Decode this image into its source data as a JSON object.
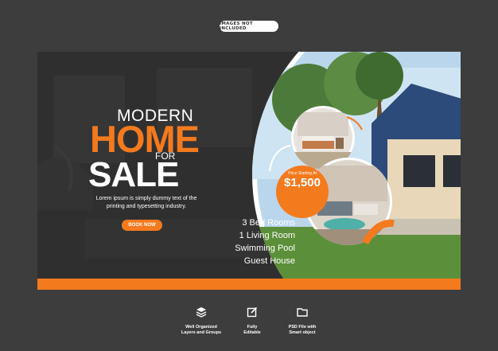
{
  "badge": {
    "label": "IMAGES NOT INCLUDED"
  },
  "headline": {
    "line1": "MODERN",
    "line2": "HOME",
    "line3": "FOR",
    "line4": "SALE"
  },
  "description": "Lorem ipsum is simply dummy text of the printing and typesetting industry.",
  "cta": {
    "label": "BOOK NOW"
  },
  "price": {
    "caption": "Price Starting At",
    "value": "$1,500"
  },
  "features": [
    "3 Bed Rooms",
    "1 Living Room",
    "Swimming Pool",
    "Guest House"
  ],
  "footer_icons": [
    {
      "icon": "layers-icon",
      "label": "Well Organized\nLayers and Groups"
    },
    {
      "icon": "edit-icon",
      "label": "Fully\nEditable"
    },
    {
      "icon": "folder-icon",
      "label": "PSD File with\nSmart object"
    }
  ],
  "colors": {
    "accent": "#f47a1e",
    "banner": "#2b2b2b",
    "background": "#3d3d3d"
  }
}
